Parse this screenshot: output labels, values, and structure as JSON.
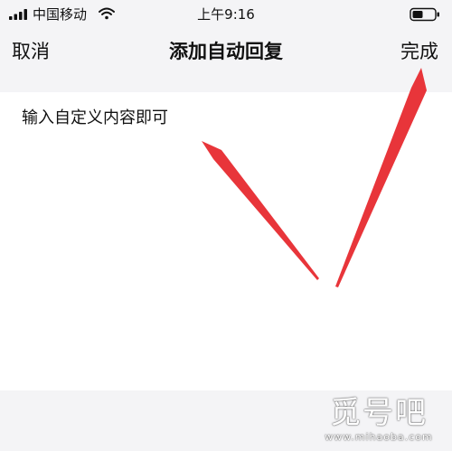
{
  "status_bar": {
    "carrier": "中国移动",
    "time": "上午9:16",
    "icons": [
      "signal-icon",
      "wifi-icon",
      "battery-icon"
    ]
  },
  "nav_bar": {
    "cancel_label": "取消",
    "title": "添加自动回复",
    "done_label": "完成"
  },
  "editor": {
    "text": "输入自定义内容即可"
  },
  "annotations": {
    "arrow_color": "#e8353a",
    "arrow_targets": [
      "editor-text",
      "done-button"
    ]
  },
  "watermark": {
    "main": "觅号吧",
    "url": "www.mihaoba.com"
  },
  "colors": {
    "background": "#f4f4f6",
    "editor_background": "#ffffff",
    "text": "#111111"
  }
}
